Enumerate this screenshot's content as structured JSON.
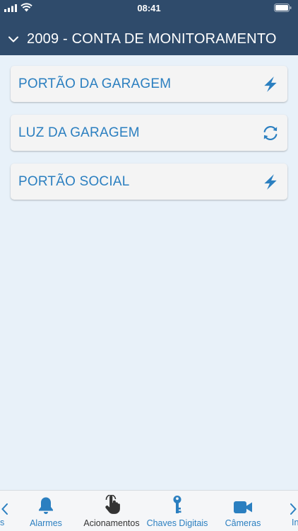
{
  "status": {
    "time": "08:41"
  },
  "header": {
    "title": "2009 - CONTA DE MONITORAMENTO"
  },
  "items": [
    {
      "label": "PORTÃO DA GARAGEM",
      "icon": "lightning-icon"
    },
    {
      "label": "LUZ DA GARAGEM",
      "icon": "refresh-icon"
    },
    {
      "label": "PORTÃO SOCIAL",
      "icon": "lightning-icon"
    }
  ],
  "tabs": {
    "left_partial": "s",
    "right_partial": "In",
    "items": [
      {
        "label": "Alarmes",
        "icon": "bell-icon"
      },
      {
        "label": "Acionamentos",
        "icon": "hand-pointer-icon",
        "active": true
      },
      {
        "label": "Chaves Digitais",
        "icon": "key-icon"
      },
      {
        "label": "Câmeras",
        "icon": "video-camera-icon"
      }
    ]
  },
  "colors": {
    "header_bg": "#2f4b6b",
    "accent": "#2b7fc0",
    "page_bg": "#e8f1f9",
    "card_bg": "#f4f4f4"
  }
}
